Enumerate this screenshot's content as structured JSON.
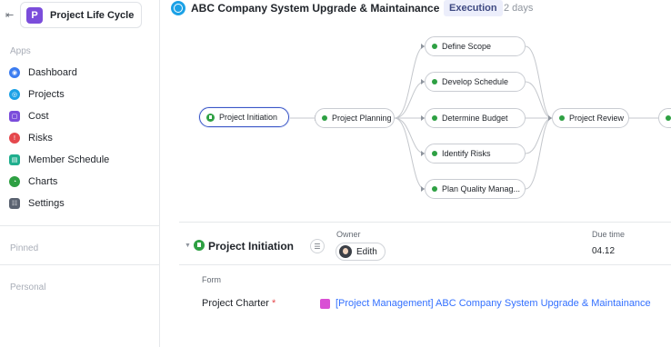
{
  "sidebar": {
    "project": {
      "avatar_letter": "P",
      "name": "Project Life Cycle"
    },
    "apps_label": "Apps",
    "items": [
      {
        "label": "Dashboard",
        "icon": "dashboard-icon",
        "color": "#3b7cf0"
      },
      {
        "label": "Projects",
        "icon": "projects-icon",
        "color": "#1ba1e6"
      },
      {
        "label": "Cost",
        "icon": "cost-icon",
        "color": "#7b4ddb"
      },
      {
        "label": "Risks",
        "icon": "risks-icon",
        "color": "#e5484d"
      },
      {
        "label": "Member Schedule",
        "icon": "schedule-icon",
        "color": "#1fae8d"
      },
      {
        "label": "Charts",
        "icon": "charts-icon",
        "color": "#2ea043"
      },
      {
        "label": "Settings",
        "icon": "settings-icon",
        "color": "#5a6270"
      }
    ],
    "pinned_label": "Pinned",
    "personal_label": "Personal"
  },
  "header": {
    "title": "ABC Company System Upgrade & Maintainance",
    "status": "Execution",
    "duration": "2 days"
  },
  "flow": {
    "nodes": [
      {
        "id": "initiation",
        "label": "Project Initiation",
        "active": true
      },
      {
        "id": "planning",
        "label": "Project Planning"
      },
      {
        "id": "scope",
        "label": "Define Scope"
      },
      {
        "id": "schedule",
        "label": "Develop Schedule"
      },
      {
        "id": "budget",
        "label": "Determine Budget"
      },
      {
        "id": "risks",
        "label": "Identify Risks"
      },
      {
        "id": "quality",
        "label": "Plan Quality Manag..."
      },
      {
        "id": "review",
        "label": "Project Review"
      }
    ]
  },
  "detail": {
    "title": "Project Initiation",
    "owner_label": "Owner",
    "owner_name": "Edith",
    "due_label": "Due time",
    "due_value": "04.12",
    "form_label": "Form",
    "field_name": "Project Charter",
    "required_mark": "*",
    "document_link": "[Project Management] ABC Company System Upgrade & Maintainance"
  }
}
